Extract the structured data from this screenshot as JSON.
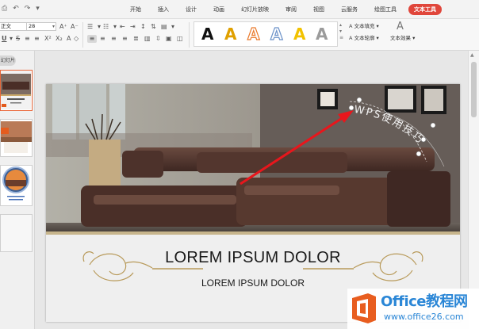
{
  "toolbar": {
    "quick_access": [
      "print",
      "undo",
      "redo",
      "dropdown"
    ],
    "tabs": [
      {
        "label": "开始"
      },
      {
        "label": "插入"
      },
      {
        "label": "设计"
      },
      {
        "label": "动画"
      },
      {
        "label": "幻灯片放映"
      },
      {
        "label": "审阅"
      },
      {
        "label": "视图"
      },
      {
        "label": "云服务"
      },
      {
        "label": "绘图工具"
      },
      {
        "label": "文本工具"
      }
    ],
    "active_tab": "文本工具"
  },
  "ribbon": {
    "font_name": "正文",
    "font_size": "28",
    "wordart_styles": [
      {
        "glyph": "A",
        "style": "black-solid",
        "color": "#111111"
      },
      {
        "glyph": "A",
        "style": "gold-solid",
        "color": "#e0a000"
      },
      {
        "glyph": "A",
        "style": "orange-outline",
        "color": "#ea7a2c"
      },
      {
        "glyph": "A",
        "style": "blue-outline",
        "color": "#6c92c9"
      },
      {
        "glyph": "A",
        "style": "yellow-solid",
        "color": "#f2c200"
      },
      {
        "glyph": "A",
        "style": "gray-gradient",
        "color": "#8a8a8a"
      }
    ],
    "text_fill_label": "文本填充",
    "text_outline_label": "文本轮廓",
    "text_effect_label": "文本效果"
  },
  "left_panel": {
    "tab_label": "幻灯片"
  },
  "slide": {
    "title": "LOREM IPSUM DOLOR",
    "subtitle": "LOREM IPSUM DOLOR",
    "arc_text": "WPS使用技巧"
  },
  "watermark": {
    "brand_main": "Office教程网",
    "brand_url": "www.office26.com",
    "logo_color": "#e85d1f",
    "text_color": "#2a86d6"
  },
  "accent_color": "#e0463b"
}
